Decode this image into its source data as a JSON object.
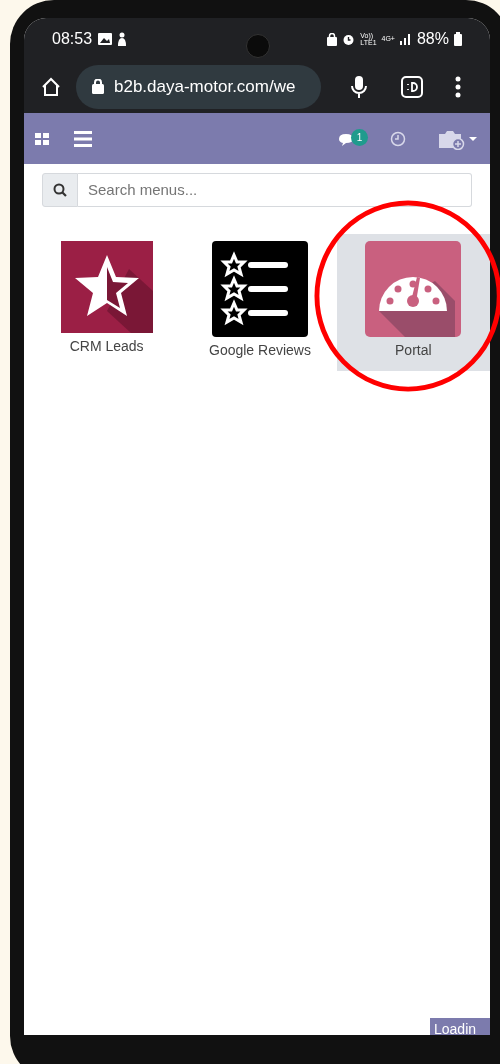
{
  "status_bar": {
    "time": "08:53",
    "volte": "Vo))",
    "lte": "LTE1",
    "network": "4G+",
    "battery": "88%"
  },
  "browser": {
    "url": "b2b.daya-motor.com/we"
  },
  "app_bar": {
    "messages_count": "1"
  },
  "search": {
    "placeholder": "Search menus..."
  },
  "apps": [
    {
      "label": "CRM Leads",
      "kind": "crm",
      "selected": false
    },
    {
      "label": "Google Reviews",
      "kind": "reviews",
      "selected": false
    },
    {
      "label": "Portal",
      "kind": "portal",
      "selected": true
    }
  ],
  "loading": {
    "label": "Loadin"
  }
}
